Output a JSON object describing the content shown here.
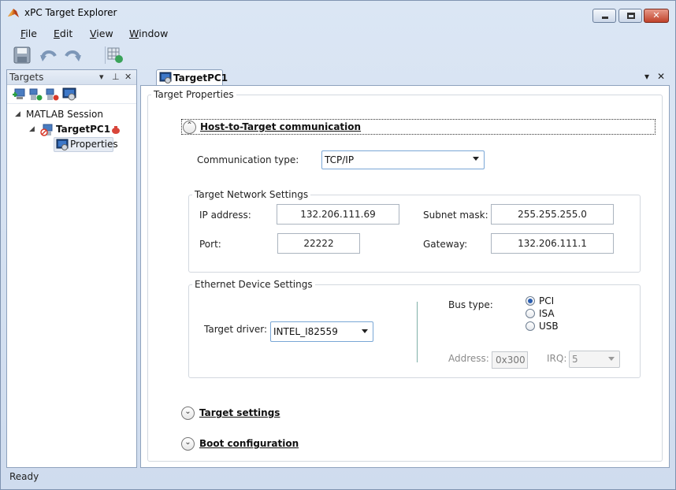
{
  "window": {
    "title": "xPC Target Explorer"
  },
  "menu": [
    "File",
    "Edit",
    "View",
    "Window"
  ],
  "toolbar": {
    "icons": [
      "save-icon",
      "undo-icon",
      "redo-icon",
      "target-connect-icon"
    ]
  },
  "left_panel": {
    "title": "Targets",
    "tools": [
      "add-target-icon",
      "connect-icon",
      "disconnect-icon",
      "target-settings-icon"
    ],
    "tree": {
      "root": "MATLAB Session",
      "target": "TargetPC1",
      "child": "Properties"
    }
  },
  "tab": {
    "label": "TargetPC1"
  },
  "properties": {
    "group_title": "Target Properties",
    "sections": {
      "host_comm": "Host-to-Target communication",
      "target_settings": "Target settings",
      "boot_config": "Boot configuration"
    },
    "comm": {
      "label": "Communication type:",
      "value": "TCP/IP"
    },
    "network": {
      "title": "Target Network Settings",
      "ip_label": "IP address:",
      "ip_value": "132.206.111.69",
      "subnet_label": "Subnet mask:",
      "subnet_value": "255.255.255.0",
      "port_label": "Port:",
      "port_value": "22222",
      "gateway_label": "Gateway:",
      "gateway_value": "132.206.111.1"
    },
    "ethernet": {
      "title": "Ethernet Device Settings",
      "driver_label": "Target driver:",
      "driver_value": "INTEL_I82559",
      "bus_label": "Bus type:",
      "bus_options": [
        "PCI",
        "ISA",
        "USB"
      ],
      "bus_selected": "PCI",
      "address_label": "Address:",
      "address_value": "0x300",
      "irq_label": "IRQ:",
      "irq_value": "5"
    }
  },
  "status": "Ready"
}
